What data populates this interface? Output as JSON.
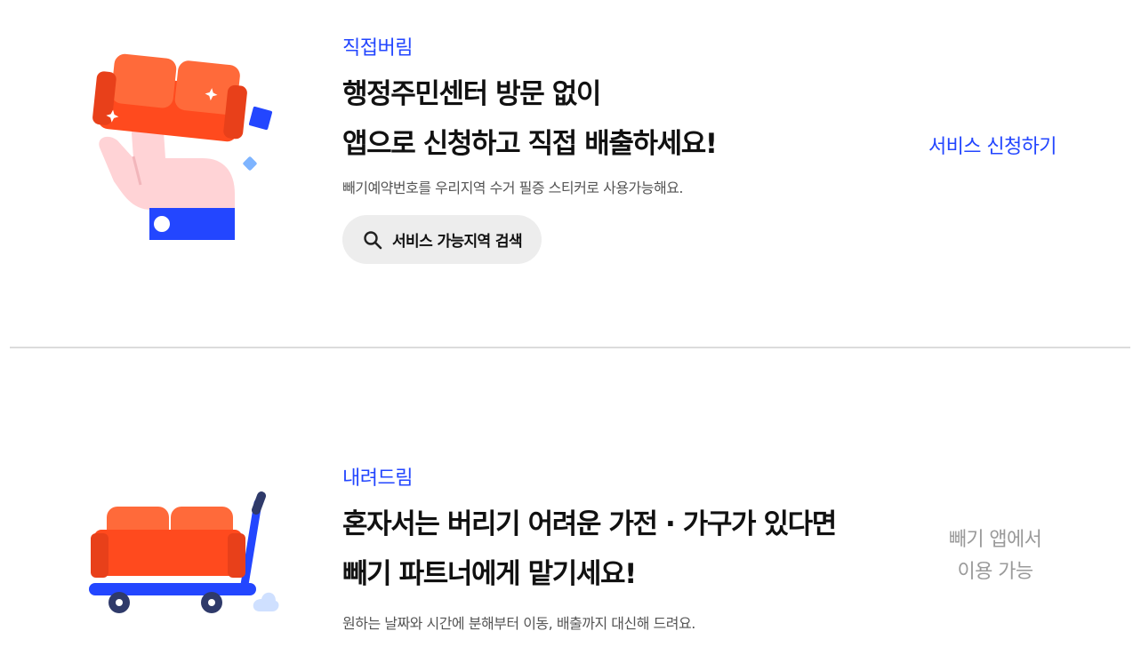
{
  "direct": {
    "eyebrow": "직접버림",
    "headline_line1": "행정주민센터 방문 없이",
    "headline_line2": "앱으로 신청하고 직접 배출하세요!",
    "description": "빼기예약번호를 우리지역 수거 필증 스티커로 사용가능해요.",
    "search_button": "서비스 가능지역 검색",
    "apply_link": "서비스 신청하기",
    "icon": "search-icon"
  },
  "pickup": {
    "eyebrow": "내려드림",
    "headline_line1": "혼자서는 버리기 어려운 가전 · 가구가 있다면",
    "headline_line2": "빼기 파트너에게 맡기세요!",
    "description": "원하는 날짜와 시간에 분해부터 이동, 배출까지 대신해 드려요.",
    "availability_line1": "빼기 앱에서",
    "availability_line2": "이용 가능"
  },
  "colors": {
    "accent": "#2346ff",
    "sofa": "#ff5a2a",
    "muted": "#9a9a9a"
  }
}
